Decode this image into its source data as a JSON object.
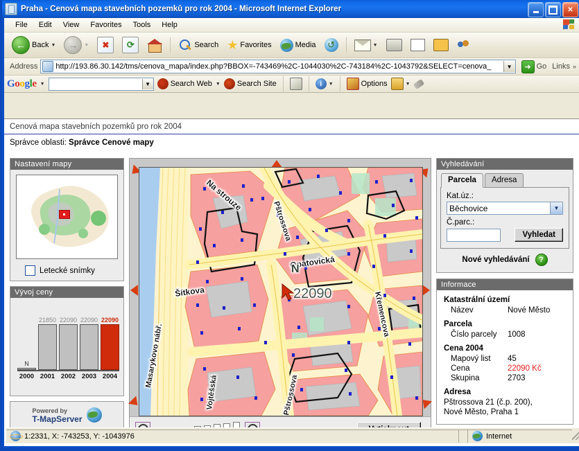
{
  "window": {
    "title": "Praha - Cenová mapa stavebních pozemků pro rok 2004 - Microsoft Internet Explorer",
    "minimize_label": "Minimize",
    "maximize_label": "Maximize",
    "close_label": "Close"
  },
  "menu": {
    "items": [
      "File",
      "Edit",
      "View",
      "Favorites",
      "Tools",
      "Help"
    ]
  },
  "toolbar": {
    "back": "Back",
    "forward": "Forward",
    "stop": "Stop",
    "refresh": "Refresh",
    "home": "Home",
    "search": "Search",
    "favorites": "Favorites",
    "media": "Media",
    "history": "History",
    "mail": "Mail",
    "print": "Print",
    "edit": "Edit",
    "discuss": "Discuss",
    "messenger": "Messenger"
  },
  "address": {
    "label": "Address",
    "url": "http://193.86.30.142/tms/cenova_mapa/index.php?BBOX=-743469%2C-1044030%2C-743184%2C-1043792&SELECT=cenova_",
    "go": "Go",
    "links": "Links"
  },
  "google_bar": {
    "logo": [
      "G",
      "o",
      "o",
      "g",
      "l",
      "e"
    ],
    "query": "",
    "search_web": "Search Web",
    "search_site": "Search Site",
    "options": "Options",
    "news_icon": "news-icon",
    "info_icon": "info-icon",
    "popup_blocker_icon": "popup-blocker-icon",
    "autofill_icon": "autofill-icon",
    "highlight_icon": "highlight-icon"
  },
  "page": {
    "heading": "Cenová mapa stavebních pozemků pro rok 2004",
    "manager_label": "Správce oblasti:",
    "manager_value": "Správce Cenové mapy"
  },
  "map_settings": {
    "title": "Nastavení mapy",
    "aerial_label": "Letecké snímky",
    "aerial_checked": false
  },
  "chart_data": {
    "type": "bar",
    "title": "Vývoj ceny",
    "categories": [
      "2000",
      "2001",
      "2002",
      "2003",
      "2004"
    ],
    "values": [
      0,
      21850,
      22090,
      22090,
      22090
    ],
    "value_labels": [
      "N",
      "21850",
      "22090",
      "22090",
      "22090"
    ],
    "highlight_index": 4,
    "highlight_color": "#d02b0b",
    "bar_color": "#c0c0c0",
    "xlabel": "",
    "ylabel": "",
    "ylim": [
      0,
      24000
    ],
    "grid": false,
    "legend": "none"
  },
  "branding": {
    "powered_by": "Powered by",
    "product": "T-MapServer"
  },
  "map": {
    "street_labels": [
      "Na strouze",
      "Pštrossova",
      "Opatovická",
      "Šítkova",
      "Masarykovo nábř.",
      "Vojtěšská",
      "Pštrossova",
      "Křemencova"
    ],
    "price_label": "22090",
    "north_label": "N",
    "nav_arrow": "nav-arrow"
  },
  "map_tools": {
    "zoom_out": "zoom-out",
    "zoom_in": "zoom-in",
    "scale_steps": 9,
    "active_scale_step": 8,
    "print_label": "Vytisknout"
  },
  "search": {
    "title": "Vyhledávání",
    "tabs": [
      {
        "label": "Parcela",
        "active": true
      },
      {
        "label": "Adresa",
        "active": false
      }
    ],
    "katuz_label": "Kat.úz.:",
    "katuz_value": "Běchovice",
    "parc_label": "Č.parc.:",
    "parc_value": "",
    "submit_label": "Vyhledat",
    "new_search_label": "Nové vyhledávání",
    "help_icon": "help-icon"
  },
  "info": {
    "title": "Informace",
    "sections": [
      {
        "heading": "Katastrální území",
        "rows": [
          {
            "key": "Název",
            "value": "Nové Město",
            "red": false
          }
        ]
      },
      {
        "heading": "Parcela",
        "rows": [
          {
            "key": "Číslo parcely",
            "value": "1008",
            "red": false
          }
        ]
      },
      {
        "heading": "Cena 2004",
        "rows": [
          {
            "key": "Mapový list",
            "value": "45",
            "red": false
          },
          {
            "key": "Cena",
            "value": "22090 Kč",
            "red": true
          },
          {
            "key": "Skupina",
            "value": "2703",
            "red": false
          }
        ]
      }
    ],
    "address_heading": "Adresa",
    "address_line1": "Pštrossova 21 (č.p. 200),",
    "address_line2": "Nové Město, Praha 1"
  },
  "status": {
    "coords": "1:2331, X: -743253, Y: -1043976",
    "zone": "Internet"
  },
  "colors": {
    "accent_red": "#d02b0b",
    "panel_header": "#6b6b6b",
    "title_blue": "#0b4ec4",
    "parcel_pink": "#f6a0a0"
  }
}
